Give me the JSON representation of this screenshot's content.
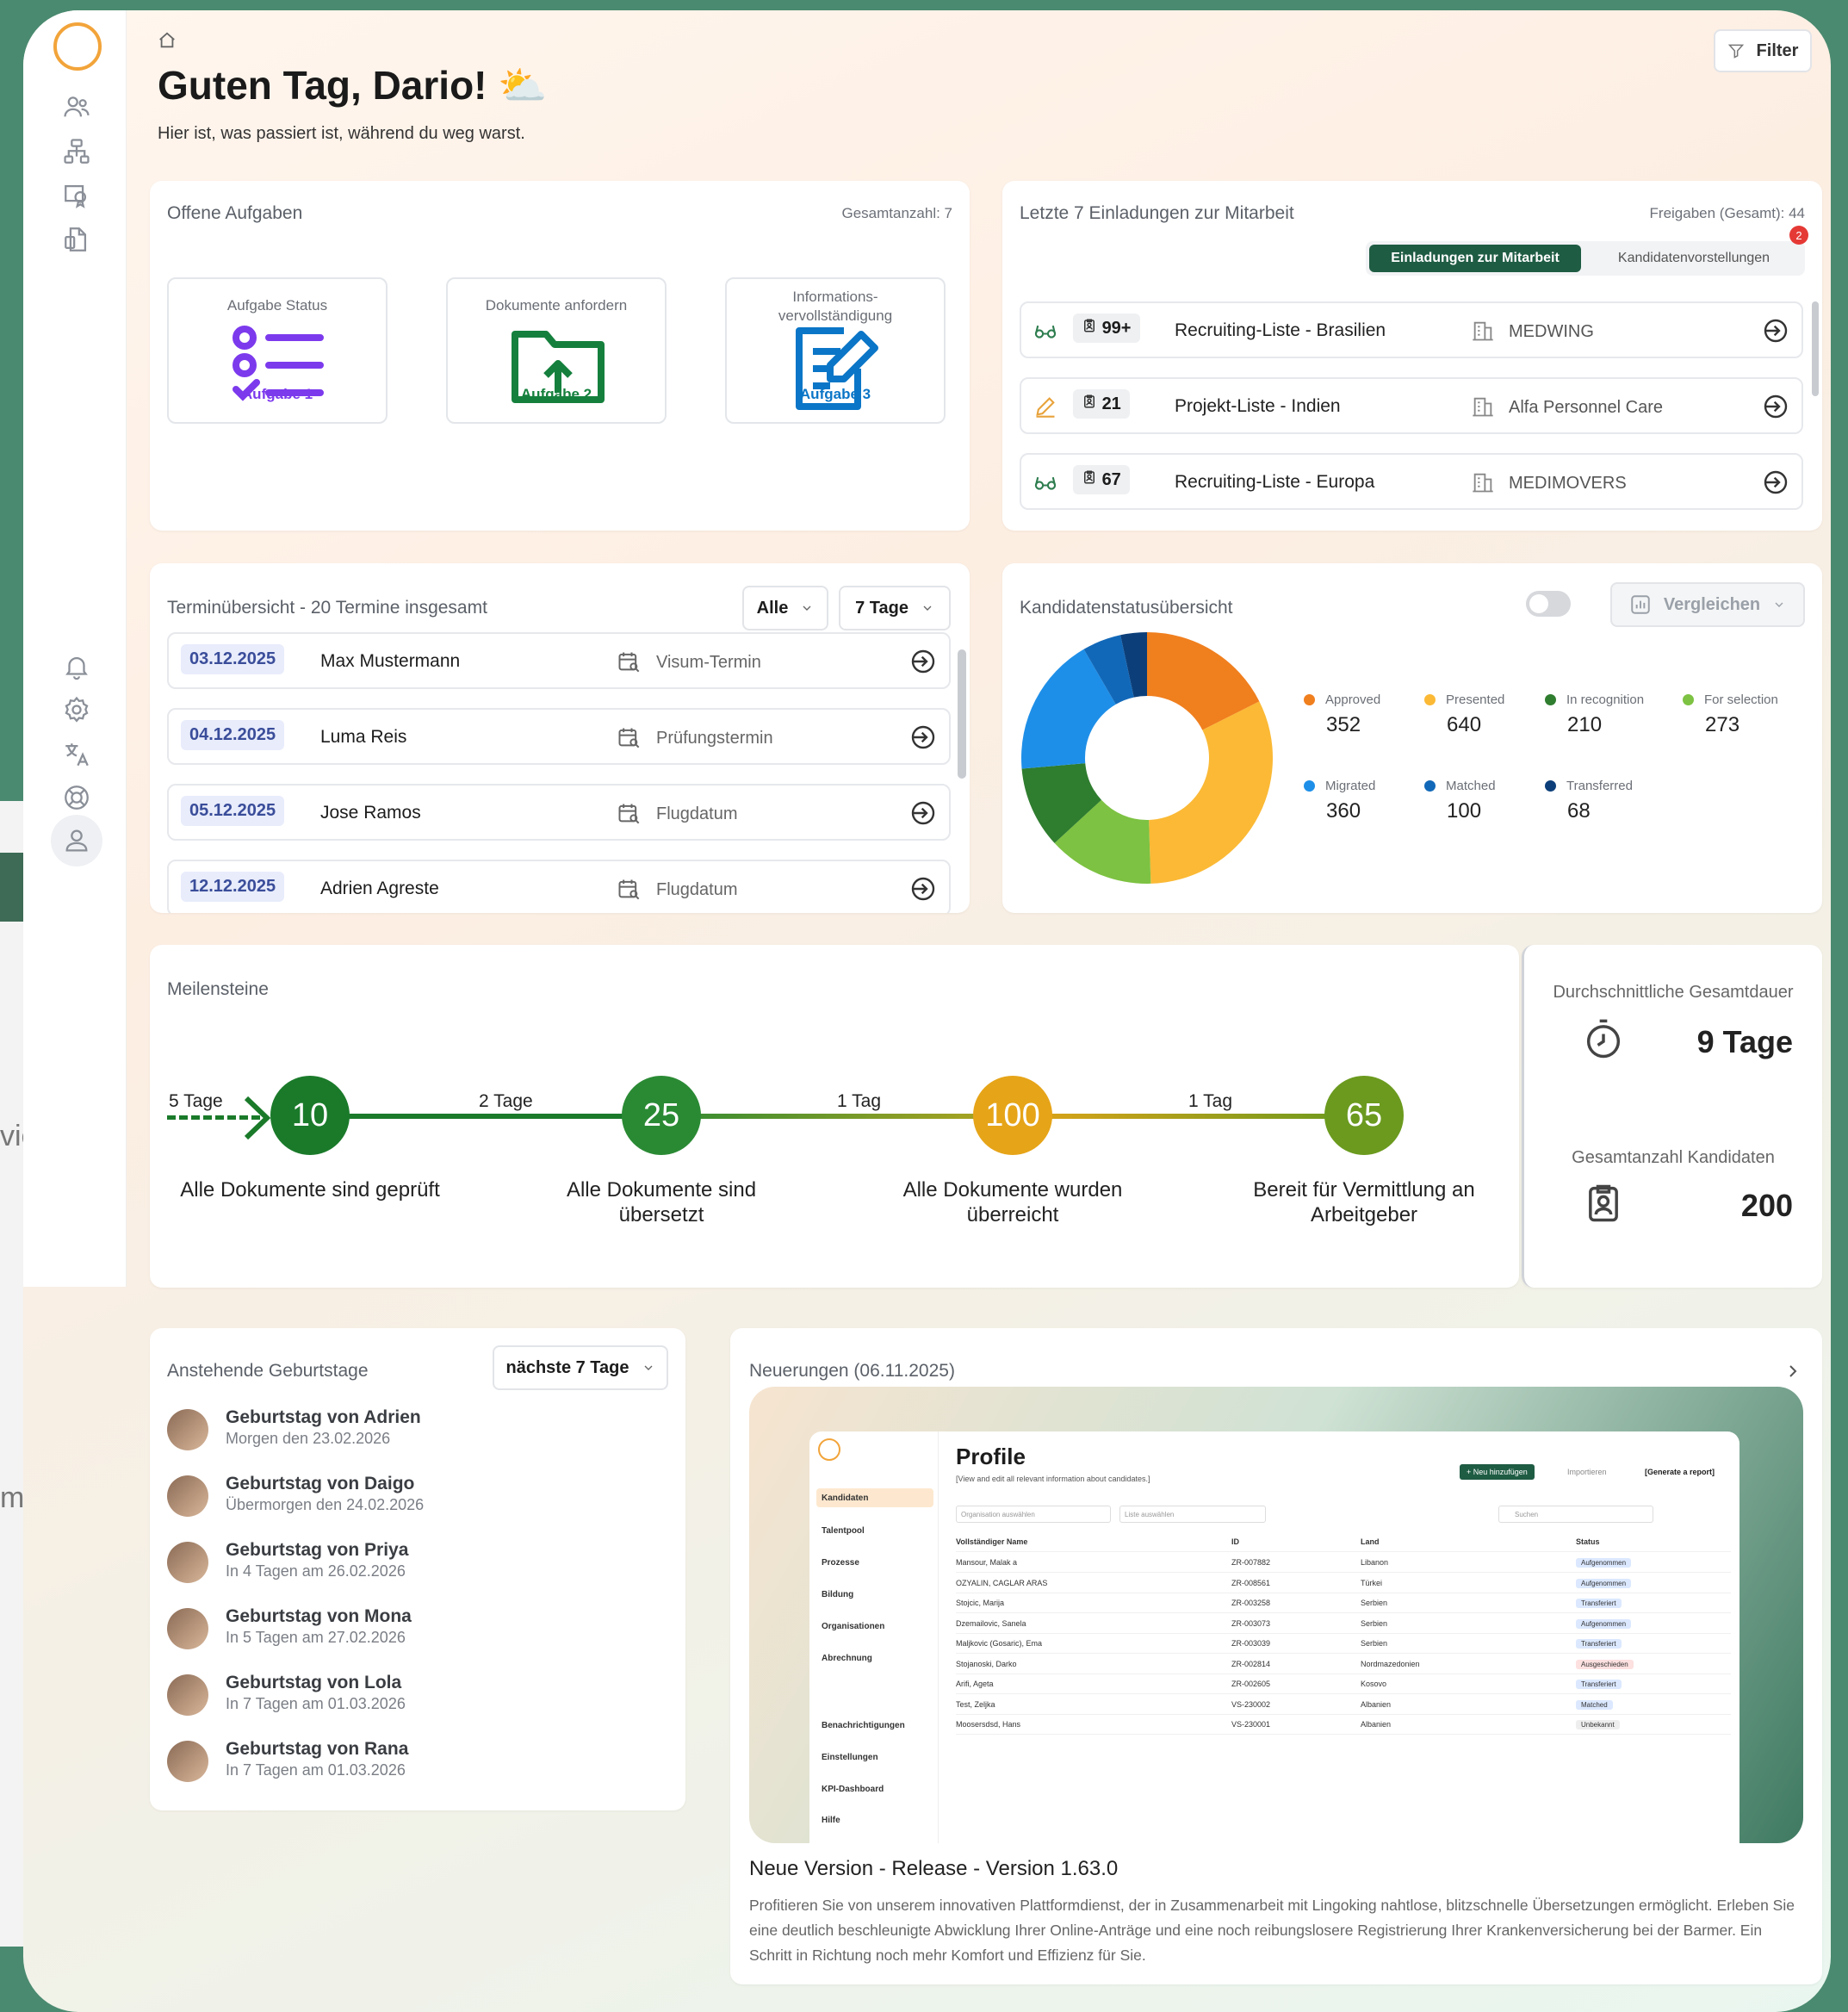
{
  "background_window": {
    "fragment_1": "vie",
    "fragment_2": "me"
  },
  "header": {
    "greeting": "Guten Tag, Dario!",
    "greeting_emoji": "⛅",
    "subtitle": "Hier ist, was passiert ist, während du weg warst.",
    "filter_label": "Filter"
  },
  "tasks": {
    "title": "Offene Aufgaben",
    "total": "Gesamtanzahl: 7",
    "items": [
      {
        "label": "Aufgabe Status",
        "action": "Aufgabe 1",
        "color": "#7c3aed"
      },
      {
        "label": "Dokumente anfordern",
        "action": "Aufgabe 2",
        "color": "#15803d"
      },
      {
        "label": "Informations-\nvervollständigung",
        "action": "Aufgabe 3",
        "color": "#0b76c7"
      }
    ]
  },
  "invitations": {
    "title": "Letzte 7 Einladungen zur Mitarbeit",
    "total": "Freigaben (Gesamt): 44",
    "tab_active": "Einladungen zur Mitarbeit",
    "tab_inactive": "Kandidatenvorstellungen",
    "notification_count": "2",
    "rows": [
      {
        "icon": "glasses-icon",
        "count": "99+",
        "list": "Recruiting-Liste - Brasilien",
        "company": "MEDWING"
      },
      {
        "icon": "pencil-icon",
        "count": "21",
        "list": "Projekt-Liste - Indien",
        "company": "Alfa Personnel Care"
      },
      {
        "icon": "glasses-icon",
        "count": "67",
        "list": "Recruiting-Liste - Europa",
        "company": "MEDIMOVERS"
      }
    ]
  },
  "appointments": {
    "title": "Terminübersicht - 20 Termine insgesamt",
    "filter_all": "Alle",
    "filter_range": "7 Tage",
    "rows": [
      {
        "date": "03.12.2025",
        "name": "Max Mustermann",
        "type": "Visum-Termin"
      },
      {
        "date": "04.12.2025",
        "name": "Luma Reis",
        "type": "Prüfungstermin"
      },
      {
        "date": "05.12.2025",
        "name": "Jose Ramos",
        "type": "Flugdatum"
      },
      {
        "date": "12.12.2025",
        "name": "Adrien Agreste",
        "type": "Flugdatum"
      }
    ]
  },
  "candidate_status": {
    "title": "Kandidatenstatusübersicht",
    "compare_label": "Vergleichen"
  },
  "chart_data": {
    "type": "pie",
    "categories": [
      "Approved",
      "Presented",
      "In recognition",
      "For selection",
      "Migrated",
      "Matched",
      "Transferred"
    ],
    "values": [
      352,
      640,
      210,
      273,
      360,
      100,
      68
    ],
    "colors": [
      "#f07f1e",
      "#fbb935",
      "#2f7d2f",
      "#7dc242",
      "#1e8fe8",
      "#1268b8",
      "#0c3f7a"
    ],
    "donut": true
  },
  "milestones": {
    "title": "Meilensteine",
    "start_gap": "5 Tage",
    "nodes": [
      {
        "value": "10",
        "label": "Alle Dokumente sind geprüft",
        "color": "#1a7a2a"
      },
      {
        "value": "25",
        "label": "Alle Dokumente sind übersetzt",
        "color": "#2a8a34"
      },
      {
        "value": "100",
        "label": "Alle Dokumente wurden überreicht",
        "color": "#e6a418"
      },
      {
        "value": "65",
        "label": "Bereit für Vermittlung an Arbeitgeber",
        "color": "#6b9a1e"
      }
    ],
    "gaps": [
      "2 Tage",
      "1 Tag",
      "1 Tag"
    ]
  },
  "stats": {
    "duration_title": "Durchschnittliche Gesamtdauer",
    "duration_value": "9 Tage",
    "candidates_title": "Gesamtanzahl Kandidaten",
    "candidates_value": "200"
  },
  "birthdays": {
    "title": "Anstehende Geburtstage",
    "range": "nächste 7 Tage",
    "items": [
      {
        "name": "Geburtstag von Adrien",
        "date": "Morgen den 23.02.2026"
      },
      {
        "name": "Geburtstag von Daigo",
        "date": "Übermorgen den 24.02.2026"
      },
      {
        "name": "Geburtstag von Priya",
        "date": "In 4 Tagen am 26.02.2026"
      },
      {
        "name": "Geburtstag von Mona",
        "date": "In 5 Tagen am 27.02.2026"
      },
      {
        "name": "Geburtstag von Lola",
        "date": "In 7 Tagen am 01.03.2026"
      },
      {
        "name": "Geburtstag von Rana",
        "date": "In 7 Tagen am 01.03.2026"
      }
    ]
  },
  "news": {
    "title": "Neuerungen (06.11.2025)",
    "release_title": "Neue Version - Release - Version 1.63.0",
    "release_text": "Profitieren Sie von unserem innovativen Plattformdienst, der in Zusammenarbeit mit Lingoking nahtlose, blitzschnelle Übersetzungen ermöglicht. Erleben Sie eine deutlich beschleunigte Abwicklung Ihrer Online-Anträge und eine noch reibungslosere Registrierung Ihrer Krankenversicherung bei der Barmer. Ein Schritt in Richtung noch mehr Komfort und Effizienz für Sie.",
    "preview": {
      "title": "Profile",
      "subtitle": "[View and edit all relevant information about candidates.]",
      "add_button": "+ Neu hinzufügen",
      "import": "Importieren",
      "report": "[Generate a report]",
      "filter_org": "Organisation auswählen",
      "filter_list": "Liste auswählen",
      "search": "Suchen",
      "nav": [
        "Kandidaten",
        "Talentpool",
        "Prozesse",
        "Bildung",
        "Organisationen",
        "Abrechnung"
      ],
      "nav_bottom": [
        "Benachrichtigungen",
        "Einstellungen",
        "KPI-Dashboard",
        "Hilfe"
      ],
      "columns": [
        "Vollständiger Name",
        "ID",
        "Land",
        "Status"
      ],
      "rows": [
        [
          "Mansour, Malak a",
          "ZR-007882",
          "Libanon",
          "Aufgenommen"
        ],
        [
          "OZYALIN, CAGLAR ARAS",
          "ZR-008561",
          "Türkei",
          "Aufgenommen"
        ],
        [
          "Stojcic, Marija",
          "ZR-003258",
          "Serbien",
          "Transferiert"
        ],
        [
          "Dzemailovic, Sanela",
          "ZR-003073",
          "Serbien",
          "Aufgenommen"
        ],
        [
          "Maljkovic (Gosaric), Ema",
          "ZR-003039",
          "Serbien",
          "Transferiert"
        ],
        [
          "Stojanoski, Darko",
          "ZR-002814",
          "Nordmazedonien",
          "Ausgeschieden"
        ],
        [
          "Arifi, Ageta",
          "ZR-002605",
          "Kosovo",
          "Transferiert"
        ],
        [
          "Test, Zeljka",
          "VS-230002",
          "Albanien",
          "Matched"
        ],
        [
          "Moosersdsd, Hans",
          "VS-230001",
          "Albanien",
          "Unbekannt"
        ]
      ]
    }
  }
}
